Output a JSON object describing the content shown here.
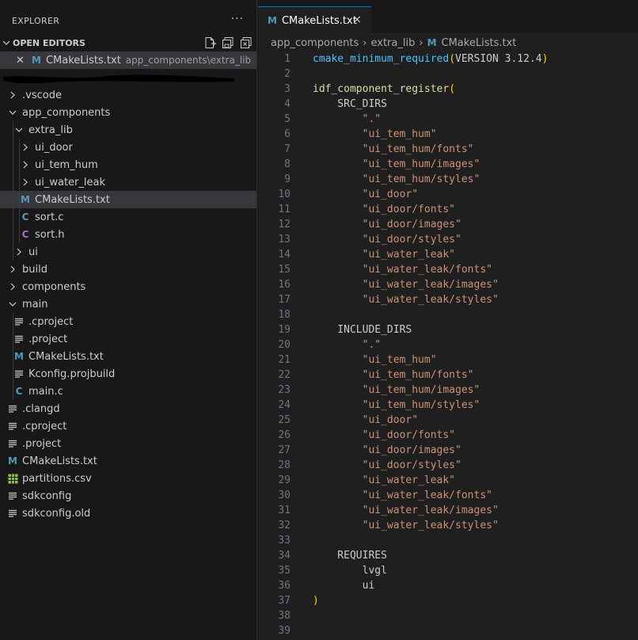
{
  "sidebar": {
    "title": "EXPLORER",
    "more": "···",
    "open_editors_label": "OPEN EDITORS",
    "open_file": {
      "name": "CMakeLists.txt",
      "path": "app_components\\extra_lib"
    },
    "tree": [
      {
        "name": ".vscode",
        "type": "folder",
        "expanded": false,
        "depth": 1
      },
      {
        "name": "app_components",
        "type": "folder",
        "expanded": true,
        "depth": 1
      },
      {
        "name": "extra_lib",
        "type": "folder",
        "expanded": true,
        "depth": 2
      },
      {
        "name": "ui_door",
        "type": "folder",
        "expanded": false,
        "depth": 3
      },
      {
        "name": "ui_tem_hum",
        "type": "folder",
        "expanded": false,
        "depth": 3
      },
      {
        "name": "ui_water_leak",
        "type": "folder",
        "expanded": false,
        "depth": 3
      },
      {
        "name": "CMakeLists.txt",
        "type": "cmake",
        "depth": 3,
        "selected": true
      },
      {
        "name": "sort.c",
        "type": "c",
        "depth": 3
      },
      {
        "name": "sort.h",
        "type": "h",
        "depth": 3
      },
      {
        "name": "ui",
        "type": "folder",
        "expanded": false,
        "depth": 2
      },
      {
        "name": "build",
        "type": "folder",
        "expanded": false,
        "depth": 1
      },
      {
        "name": "components",
        "type": "folder",
        "expanded": false,
        "depth": 1
      },
      {
        "name": "main",
        "type": "folder",
        "expanded": true,
        "depth": 1
      },
      {
        "name": ".cproject",
        "type": "text",
        "depth": 2
      },
      {
        "name": ".project",
        "type": "text",
        "depth": 2
      },
      {
        "name": "CMakeLists.txt",
        "type": "cmake",
        "depth": 2
      },
      {
        "name": "Kconfig.projbuild",
        "type": "text",
        "depth": 2
      },
      {
        "name": "main.c",
        "type": "c",
        "depth": 2
      },
      {
        "name": ".clangd",
        "type": "text",
        "depth": 1
      },
      {
        "name": ".cproject",
        "type": "text",
        "depth": 1
      },
      {
        "name": ".project",
        "type": "text",
        "depth": 1
      },
      {
        "name": "CMakeLists.txt",
        "type": "cmake",
        "depth": 1
      },
      {
        "name": "partitions.csv",
        "type": "csv",
        "depth": 1
      },
      {
        "name": "sdkconfig",
        "type": "text",
        "depth": 1
      },
      {
        "name": "sdkconfig.old",
        "type": "text",
        "depth": 1
      }
    ]
  },
  "editor": {
    "tab": {
      "name": "CMakeLists.txt",
      "close": "×"
    },
    "breadcrumb": [
      "app_components",
      "extra_lib",
      "CMakeLists.txt"
    ],
    "lines": [
      [
        [
          "fn",
          "cmake_minimum_required"
        ],
        [
          "paren",
          "("
        ],
        [
          "kw",
          "VERSION 3.12.4"
        ],
        [
          "paren",
          ")"
        ]
      ],
      [],
      [
        [
          "id",
          "idf_component_register"
        ],
        [
          "paren",
          "("
        ]
      ],
      [
        [
          "kw",
          "    SRC_DIRS"
        ]
      ],
      [
        [
          "str",
          "        \".\""
        ]
      ],
      [
        [
          "str",
          "        \"ui_tem_hum\""
        ]
      ],
      [
        [
          "str",
          "        \"ui_tem_hum/fonts\""
        ]
      ],
      [
        [
          "str",
          "        \"ui_tem_hum/images\""
        ]
      ],
      [
        [
          "str",
          "        \"ui_tem_hum/styles\""
        ]
      ],
      [
        [
          "str",
          "        \"ui_door\""
        ]
      ],
      [
        [
          "str",
          "        \"ui_door/fonts\""
        ]
      ],
      [
        [
          "str",
          "        \"ui_door/images\""
        ]
      ],
      [
        [
          "str",
          "        \"ui_door/styles\""
        ]
      ],
      [
        [
          "str",
          "        \"ui_water_leak\""
        ]
      ],
      [
        [
          "str",
          "        \"ui_water_leak/fonts\""
        ]
      ],
      [
        [
          "str",
          "        \"ui_water_leak/images\""
        ]
      ],
      [
        [
          "str",
          "        \"ui_water_leak/styles\""
        ]
      ],
      [],
      [
        [
          "kw",
          "    INCLUDE_DIRS"
        ]
      ],
      [
        [
          "str",
          "        \".\""
        ]
      ],
      [
        [
          "str",
          "        \"ui_tem_hum\""
        ]
      ],
      [
        [
          "str",
          "        \"ui_tem_hum/fonts\""
        ]
      ],
      [
        [
          "str",
          "        \"ui_tem_hum/images\""
        ]
      ],
      [
        [
          "str",
          "        \"ui_tem_hum/styles\""
        ]
      ],
      [
        [
          "str",
          "        \"ui_door\""
        ]
      ],
      [
        [
          "str",
          "        \"ui_door/fonts\""
        ]
      ],
      [
        [
          "str",
          "        \"ui_door/images\""
        ]
      ],
      [
        [
          "str",
          "        \"ui_door/styles\""
        ]
      ],
      [
        [
          "str",
          "        \"ui_water_leak\""
        ]
      ],
      [
        [
          "str",
          "        \"ui_water_leak/fonts\""
        ]
      ],
      [
        [
          "str",
          "        \"ui_water_leak/images\""
        ]
      ],
      [
        [
          "str",
          "        \"ui_water_leak/styles\""
        ]
      ],
      [],
      [
        [
          "kw",
          "    REQUIRES"
        ]
      ],
      [
        [
          "kw",
          "        lvgl"
        ]
      ],
      [
        [
          "kw",
          "        ui"
        ]
      ],
      [
        [
          "paren",
          ")"
        ]
      ],
      [],
      []
    ]
  },
  "colors": {
    "sidebar_bg": "#181818",
    "editor_bg": "#1f1f1f",
    "selection": "#37373d",
    "accent": "#0078d4",
    "string": "#ce9178",
    "function": "#4fc1ff",
    "identifier": "#dcdcaa",
    "bracket": "#ffd700",
    "cmake_icon": "#519aba",
    "c_icon": "#519aba",
    "h_icon": "#a074c4",
    "csv_icon": "#8bc34a"
  }
}
